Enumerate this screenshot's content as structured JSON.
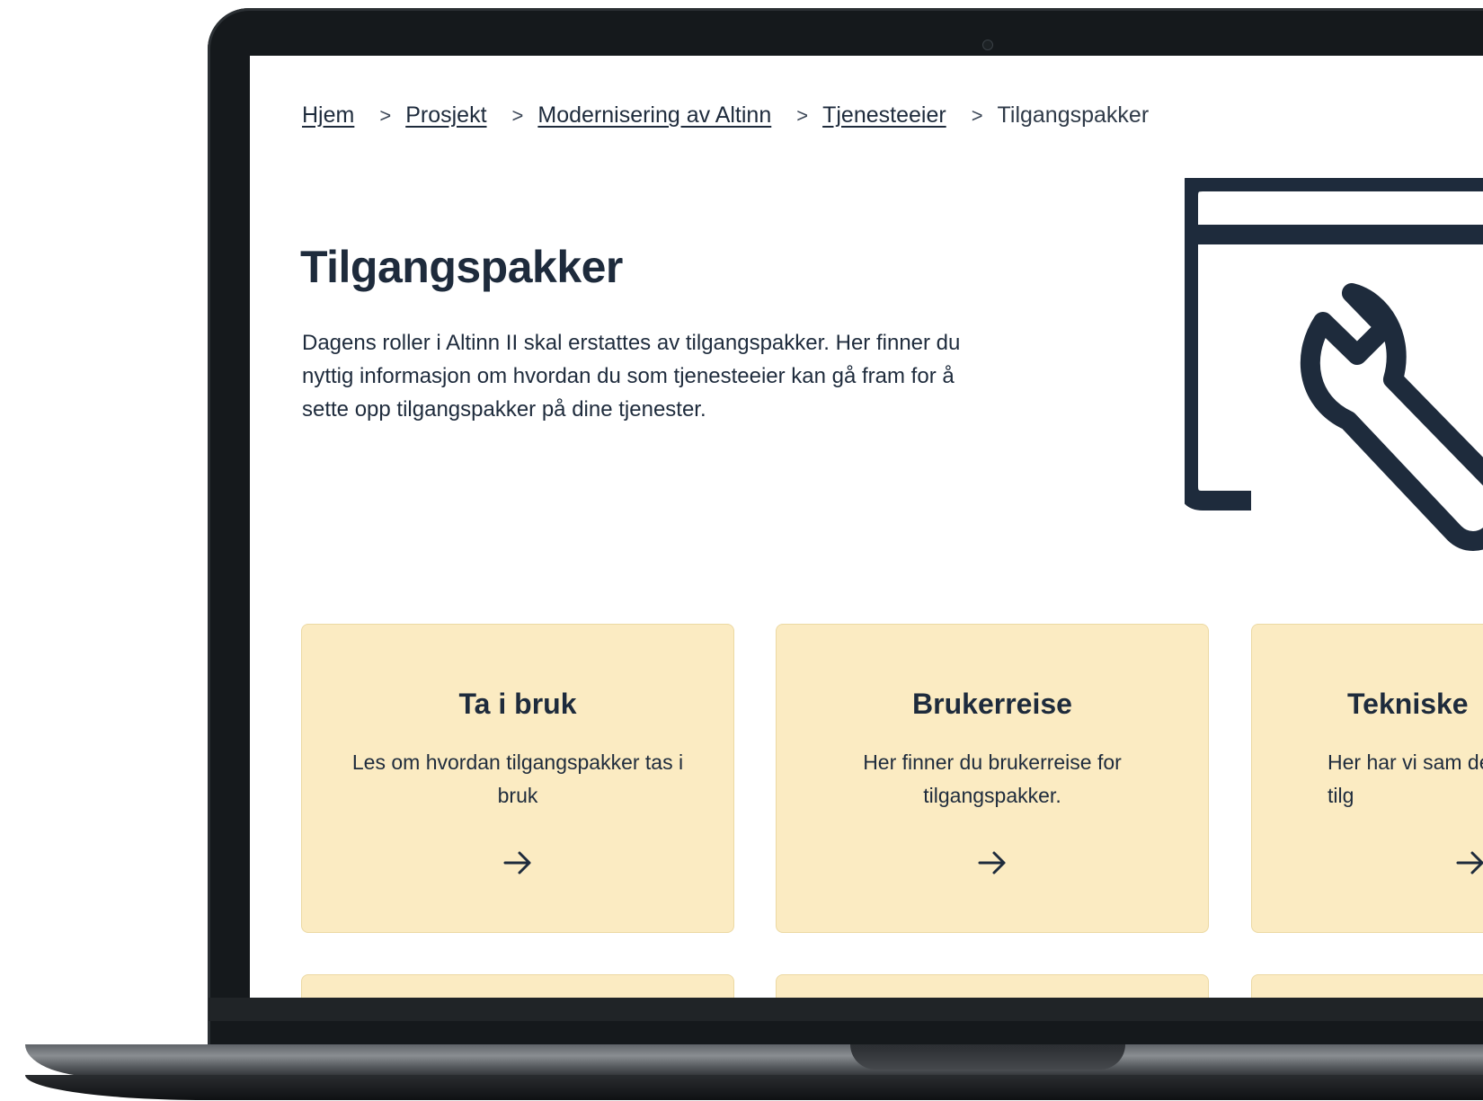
{
  "breadcrumb": {
    "items": [
      "Hjem",
      "Prosjekt",
      "Modernisering av Altinn",
      "Tjenesteeier"
    ],
    "current": "Tilgangspakker",
    "separator": ">"
  },
  "hero": {
    "title": "Tilgangspakker",
    "text": "Dagens roller i Altinn II skal erstattes av tilgangspakker. Her finner du nyttig informasjon om hvordan du som tjenesteeier kan gå fram for å sette opp tilgangspakker på dine tjenester.",
    "illustration_icon": "window-wrench-icon"
  },
  "cards": [
    {
      "title": "Ta i bruk",
      "text": "Les om hvordan tilgangspakker tas i bruk",
      "icon": "arrow-right-icon"
    },
    {
      "title": "Brukerreise",
      "text": "Her finner du brukerreise for tilgangspakker.",
      "icon": "arrow-right-icon"
    },
    {
      "title": "Tekniske",
      "text": "Her har vi sam demoer om tilg",
      "icon": "arrow-right-icon"
    }
  ],
  "colors": {
    "card_background": "#fbebc2",
    "text_primary": "#1e2b3c",
    "laptop_frame": "#15191c"
  }
}
